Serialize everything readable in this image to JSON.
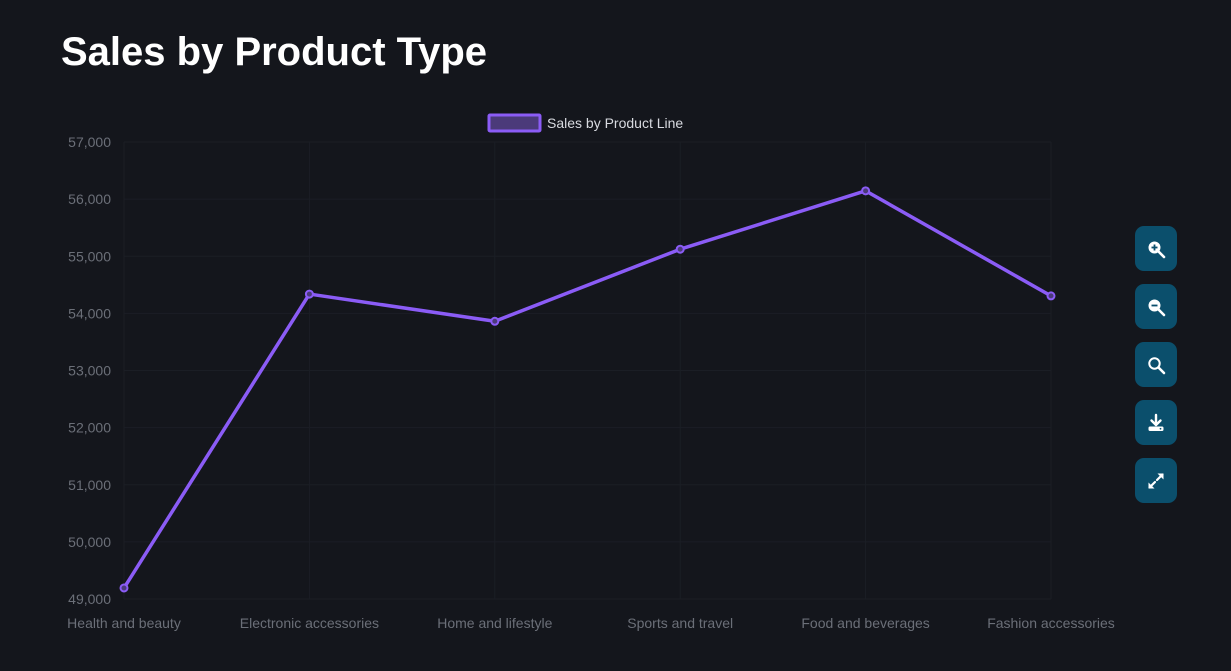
{
  "page": {
    "title": "Sales by Product Type"
  },
  "chart_data": {
    "type": "line",
    "categories": [
      "Health and beauty",
      "Electronic accessories",
      "Home and lifestyle",
      "Sports and travel",
      "Food and beverages",
      "Fashion accessories"
    ],
    "series": [
      {
        "name": "Sales by Product Line",
        "values": [
          49193,
          54338,
          53862,
          55123,
          56145,
          54306
        ],
        "color": "#8b5cf6"
      }
    ],
    "ylim": [
      49000,
      57000
    ],
    "yticks": [
      49000,
      50000,
      51000,
      52000,
      53000,
      54000,
      55000,
      56000,
      57000
    ],
    "grid": true,
    "legend_position": "top-center"
  },
  "toolbar": {
    "buttons": [
      {
        "icon": "zoom-in-icon"
      },
      {
        "icon": "zoom-out-icon"
      },
      {
        "icon": "zoom-reset-icon"
      },
      {
        "icon": "download-icon"
      },
      {
        "icon": "fullscreen-icon"
      }
    ],
    "color": "#0b4f6c"
  }
}
